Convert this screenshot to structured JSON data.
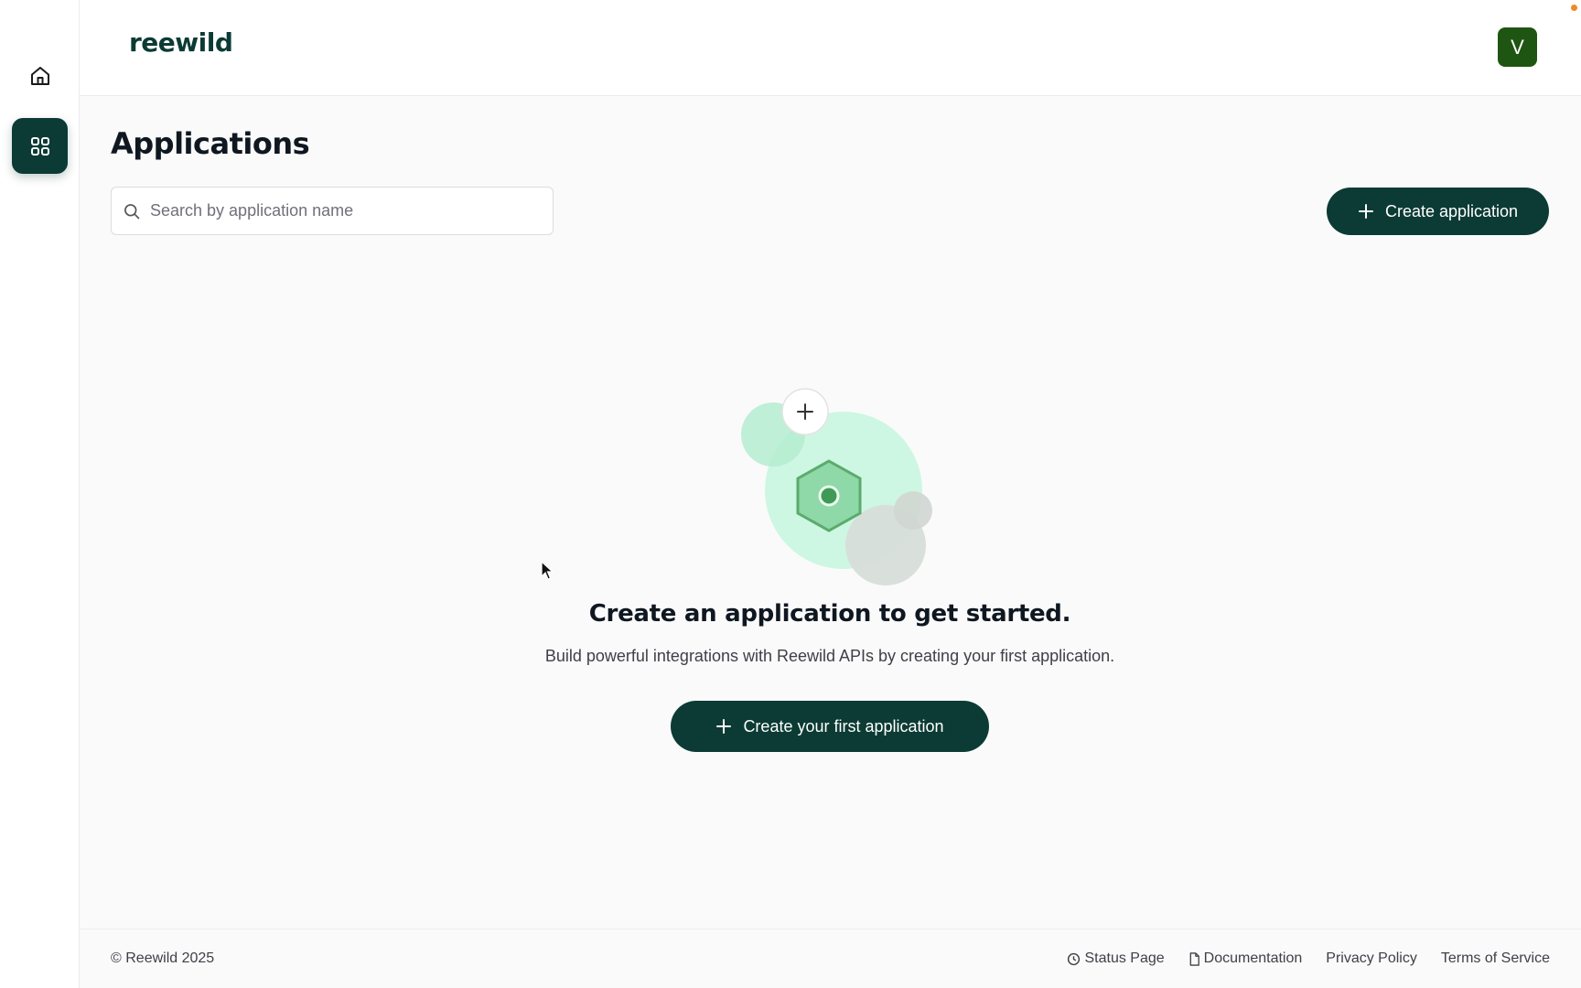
{
  "brand": {
    "logo_text": "reewild",
    "color": "#0b3b34"
  },
  "sidebar": {
    "items": [
      {
        "icon": "home-icon",
        "active": false
      },
      {
        "icon": "grid-icon",
        "active": true
      }
    ]
  },
  "header": {
    "avatar_initial": "V",
    "avatar_color": "#1f5512"
  },
  "main": {
    "title": "Applications",
    "search": {
      "placeholder": "Search by application name",
      "value": ""
    },
    "create_button_label": "Create application",
    "empty_state": {
      "title": "Create an application to get started.",
      "subtitle": "Build powerful integrations with Reewild APIs by creating your first application.",
      "button_label": "Create your first application"
    }
  },
  "footer": {
    "copyright": "© Reewild 2025",
    "links": [
      {
        "label": "Status Page",
        "icon": "clock-icon"
      },
      {
        "label": "Documentation",
        "icon": "document-icon"
      },
      {
        "label": "Privacy Policy"
      },
      {
        "label": "Terms of Service"
      }
    ]
  }
}
